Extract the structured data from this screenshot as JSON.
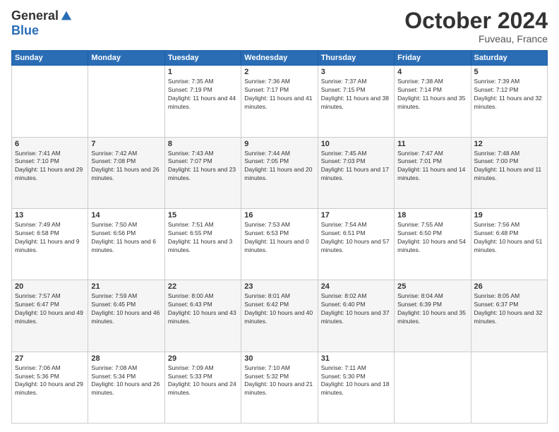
{
  "header": {
    "logo_general": "General",
    "logo_blue": "Blue",
    "month_title": "October 2024",
    "location": "Fuveau, France"
  },
  "days_of_week": [
    "Sunday",
    "Monday",
    "Tuesday",
    "Wednesday",
    "Thursday",
    "Friday",
    "Saturday"
  ],
  "weeks": [
    [
      {
        "day": "",
        "sunrise": "",
        "sunset": "",
        "daylight": ""
      },
      {
        "day": "",
        "sunrise": "",
        "sunset": "",
        "daylight": ""
      },
      {
        "day": "1",
        "sunrise": "Sunrise: 7:35 AM",
        "sunset": "Sunset: 7:19 PM",
        "daylight": "Daylight: 11 hours and 44 minutes."
      },
      {
        "day": "2",
        "sunrise": "Sunrise: 7:36 AM",
        "sunset": "Sunset: 7:17 PM",
        "daylight": "Daylight: 11 hours and 41 minutes."
      },
      {
        "day": "3",
        "sunrise": "Sunrise: 7:37 AM",
        "sunset": "Sunset: 7:15 PM",
        "daylight": "Daylight: 11 hours and 38 minutes."
      },
      {
        "day": "4",
        "sunrise": "Sunrise: 7:38 AM",
        "sunset": "Sunset: 7:14 PM",
        "daylight": "Daylight: 11 hours and 35 minutes."
      },
      {
        "day": "5",
        "sunrise": "Sunrise: 7:39 AM",
        "sunset": "Sunset: 7:12 PM",
        "daylight": "Daylight: 11 hours and 32 minutes."
      }
    ],
    [
      {
        "day": "6",
        "sunrise": "Sunrise: 7:41 AM",
        "sunset": "Sunset: 7:10 PM",
        "daylight": "Daylight: 11 hours and 29 minutes."
      },
      {
        "day": "7",
        "sunrise": "Sunrise: 7:42 AM",
        "sunset": "Sunset: 7:08 PM",
        "daylight": "Daylight: 11 hours and 26 minutes."
      },
      {
        "day": "8",
        "sunrise": "Sunrise: 7:43 AM",
        "sunset": "Sunset: 7:07 PM",
        "daylight": "Daylight: 11 hours and 23 minutes."
      },
      {
        "day": "9",
        "sunrise": "Sunrise: 7:44 AM",
        "sunset": "Sunset: 7:05 PM",
        "daylight": "Daylight: 11 hours and 20 minutes."
      },
      {
        "day": "10",
        "sunrise": "Sunrise: 7:45 AM",
        "sunset": "Sunset: 7:03 PM",
        "daylight": "Daylight: 11 hours and 17 minutes."
      },
      {
        "day": "11",
        "sunrise": "Sunrise: 7:47 AM",
        "sunset": "Sunset: 7:01 PM",
        "daylight": "Daylight: 11 hours and 14 minutes."
      },
      {
        "day": "12",
        "sunrise": "Sunrise: 7:48 AM",
        "sunset": "Sunset: 7:00 PM",
        "daylight": "Daylight: 11 hours and 11 minutes."
      }
    ],
    [
      {
        "day": "13",
        "sunrise": "Sunrise: 7:49 AM",
        "sunset": "Sunset: 6:58 PM",
        "daylight": "Daylight: 11 hours and 9 minutes."
      },
      {
        "day": "14",
        "sunrise": "Sunrise: 7:50 AM",
        "sunset": "Sunset: 6:56 PM",
        "daylight": "Daylight: 11 hours and 6 minutes."
      },
      {
        "day": "15",
        "sunrise": "Sunrise: 7:51 AM",
        "sunset": "Sunset: 6:55 PM",
        "daylight": "Daylight: 11 hours and 3 minutes."
      },
      {
        "day": "16",
        "sunrise": "Sunrise: 7:53 AM",
        "sunset": "Sunset: 6:53 PM",
        "daylight": "Daylight: 11 hours and 0 minutes."
      },
      {
        "day": "17",
        "sunrise": "Sunrise: 7:54 AM",
        "sunset": "Sunset: 6:51 PM",
        "daylight": "Daylight: 10 hours and 57 minutes."
      },
      {
        "day": "18",
        "sunrise": "Sunrise: 7:55 AM",
        "sunset": "Sunset: 6:50 PM",
        "daylight": "Daylight: 10 hours and 54 minutes."
      },
      {
        "day": "19",
        "sunrise": "Sunrise: 7:56 AM",
        "sunset": "Sunset: 6:48 PM",
        "daylight": "Daylight: 10 hours and 51 minutes."
      }
    ],
    [
      {
        "day": "20",
        "sunrise": "Sunrise: 7:57 AM",
        "sunset": "Sunset: 6:47 PM",
        "daylight": "Daylight: 10 hours and 49 minutes."
      },
      {
        "day": "21",
        "sunrise": "Sunrise: 7:59 AM",
        "sunset": "Sunset: 6:45 PM",
        "daylight": "Daylight: 10 hours and 46 minutes."
      },
      {
        "day": "22",
        "sunrise": "Sunrise: 8:00 AM",
        "sunset": "Sunset: 6:43 PM",
        "daylight": "Daylight: 10 hours and 43 minutes."
      },
      {
        "day": "23",
        "sunrise": "Sunrise: 8:01 AM",
        "sunset": "Sunset: 6:42 PM",
        "daylight": "Daylight: 10 hours and 40 minutes."
      },
      {
        "day": "24",
        "sunrise": "Sunrise: 8:02 AM",
        "sunset": "Sunset: 6:40 PM",
        "daylight": "Daylight: 10 hours and 37 minutes."
      },
      {
        "day": "25",
        "sunrise": "Sunrise: 8:04 AM",
        "sunset": "Sunset: 6:39 PM",
        "daylight": "Daylight: 10 hours and 35 minutes."
      },
      {
        "day": "26",
        "sunrise": "Sunrise: 8:05 AM",
        "sunset": "Sunset: 6:37 PM",
        "daylight": "Daylight: 10 hours and 32 minutes."
      }
    ],
    [
      {
        "day": "27",
        "sunrise": "Sunrise: 7:06 AM",
        "sunset": "Sunset: 5:36 PM",
        "daylight": "Daylight: 10 hours and 29 minutes."
      },
      {
        "day": "28",
        "sunrise": "Sunrise: 7:08 AM",
        "sunset": "Sunset: 5:34 PM",
        "daylight": "Daylight: 10 hours and 26 minutes."
      },
      {
        "day": "29",
        "sunrise": "Sunrise: 7:09 AM",
        "sunset": "Sunset: 5:33 PM",
        "daylight": "Daylight: 10 hours and 24 minutes."
      },
      {
        "day": "30",
        "sunrise": "Sunrise: 7:10 AM",
        "sunset": "Sunset: 5:32 PM",
        "daylight": "Daylight: 10 hours and 21 minutes."
      },
      {
        "day": "31",
        "sunrise": "Sunrise: 7:11 AM",
        "sunset": "Sunset: 5:30 PM",
        "daylight": "Daylight: 10 hours and 18 minutes."
      },
      {
        "day": "",
        "sunrise": "",
        "sunset": "",
        "daylight": ""
      },
      {
        "day": "",
        "sunrise": "",
        "sunset": "",
        "daylight": ""
      }
    ]
  ]
}
